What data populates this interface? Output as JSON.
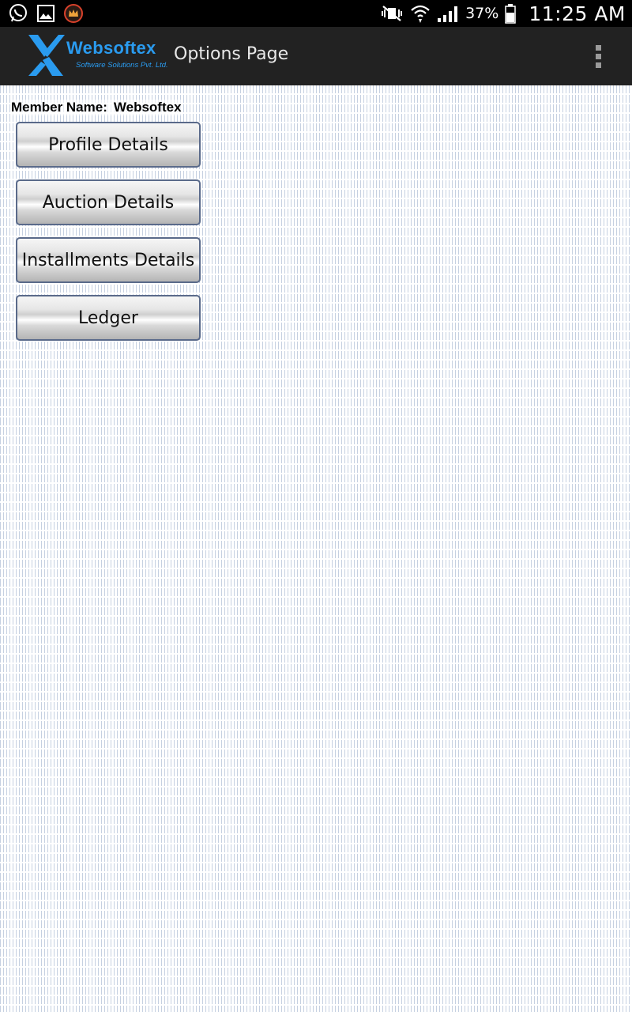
{
  "status_bar": {
    "left_icons": [
      "whatsapp-icon",
      "gallery-icon",
      "crown-app-icon"
    ],
    "right_icons": [
      "vibrate-mute-icon",
      "wifi-icon",
      "signal-icon",
      "battery-icon"
    ],
    "battery_percent": "37%",
    "time": "11:25 AM"
  },
  "action_bar": {
    "logo_wordmark": "Websoftex",
    "logo_tagline": "Software Solutions Pvt. Ltd.",
    "title": "Options Page",
    "overflow_icon": "overflow-menu-icon"
  },
  "member": {
    "label": "Member Name:",
    "value": "Websoftex"
  },
  "buttons": [
    {
      "label": "Profile Details"
    },
    {
      "label": "Auction Details"
    },
    {
      "label": "Installments Details"
    },
    {
      "label": "Ledger"
    }
  ],
  "colors": {
    "action_bar_bg": "#222222",
    "brand_blue": "#2a9bef",
    "button_border": "#5a6a8a"
  }
}
